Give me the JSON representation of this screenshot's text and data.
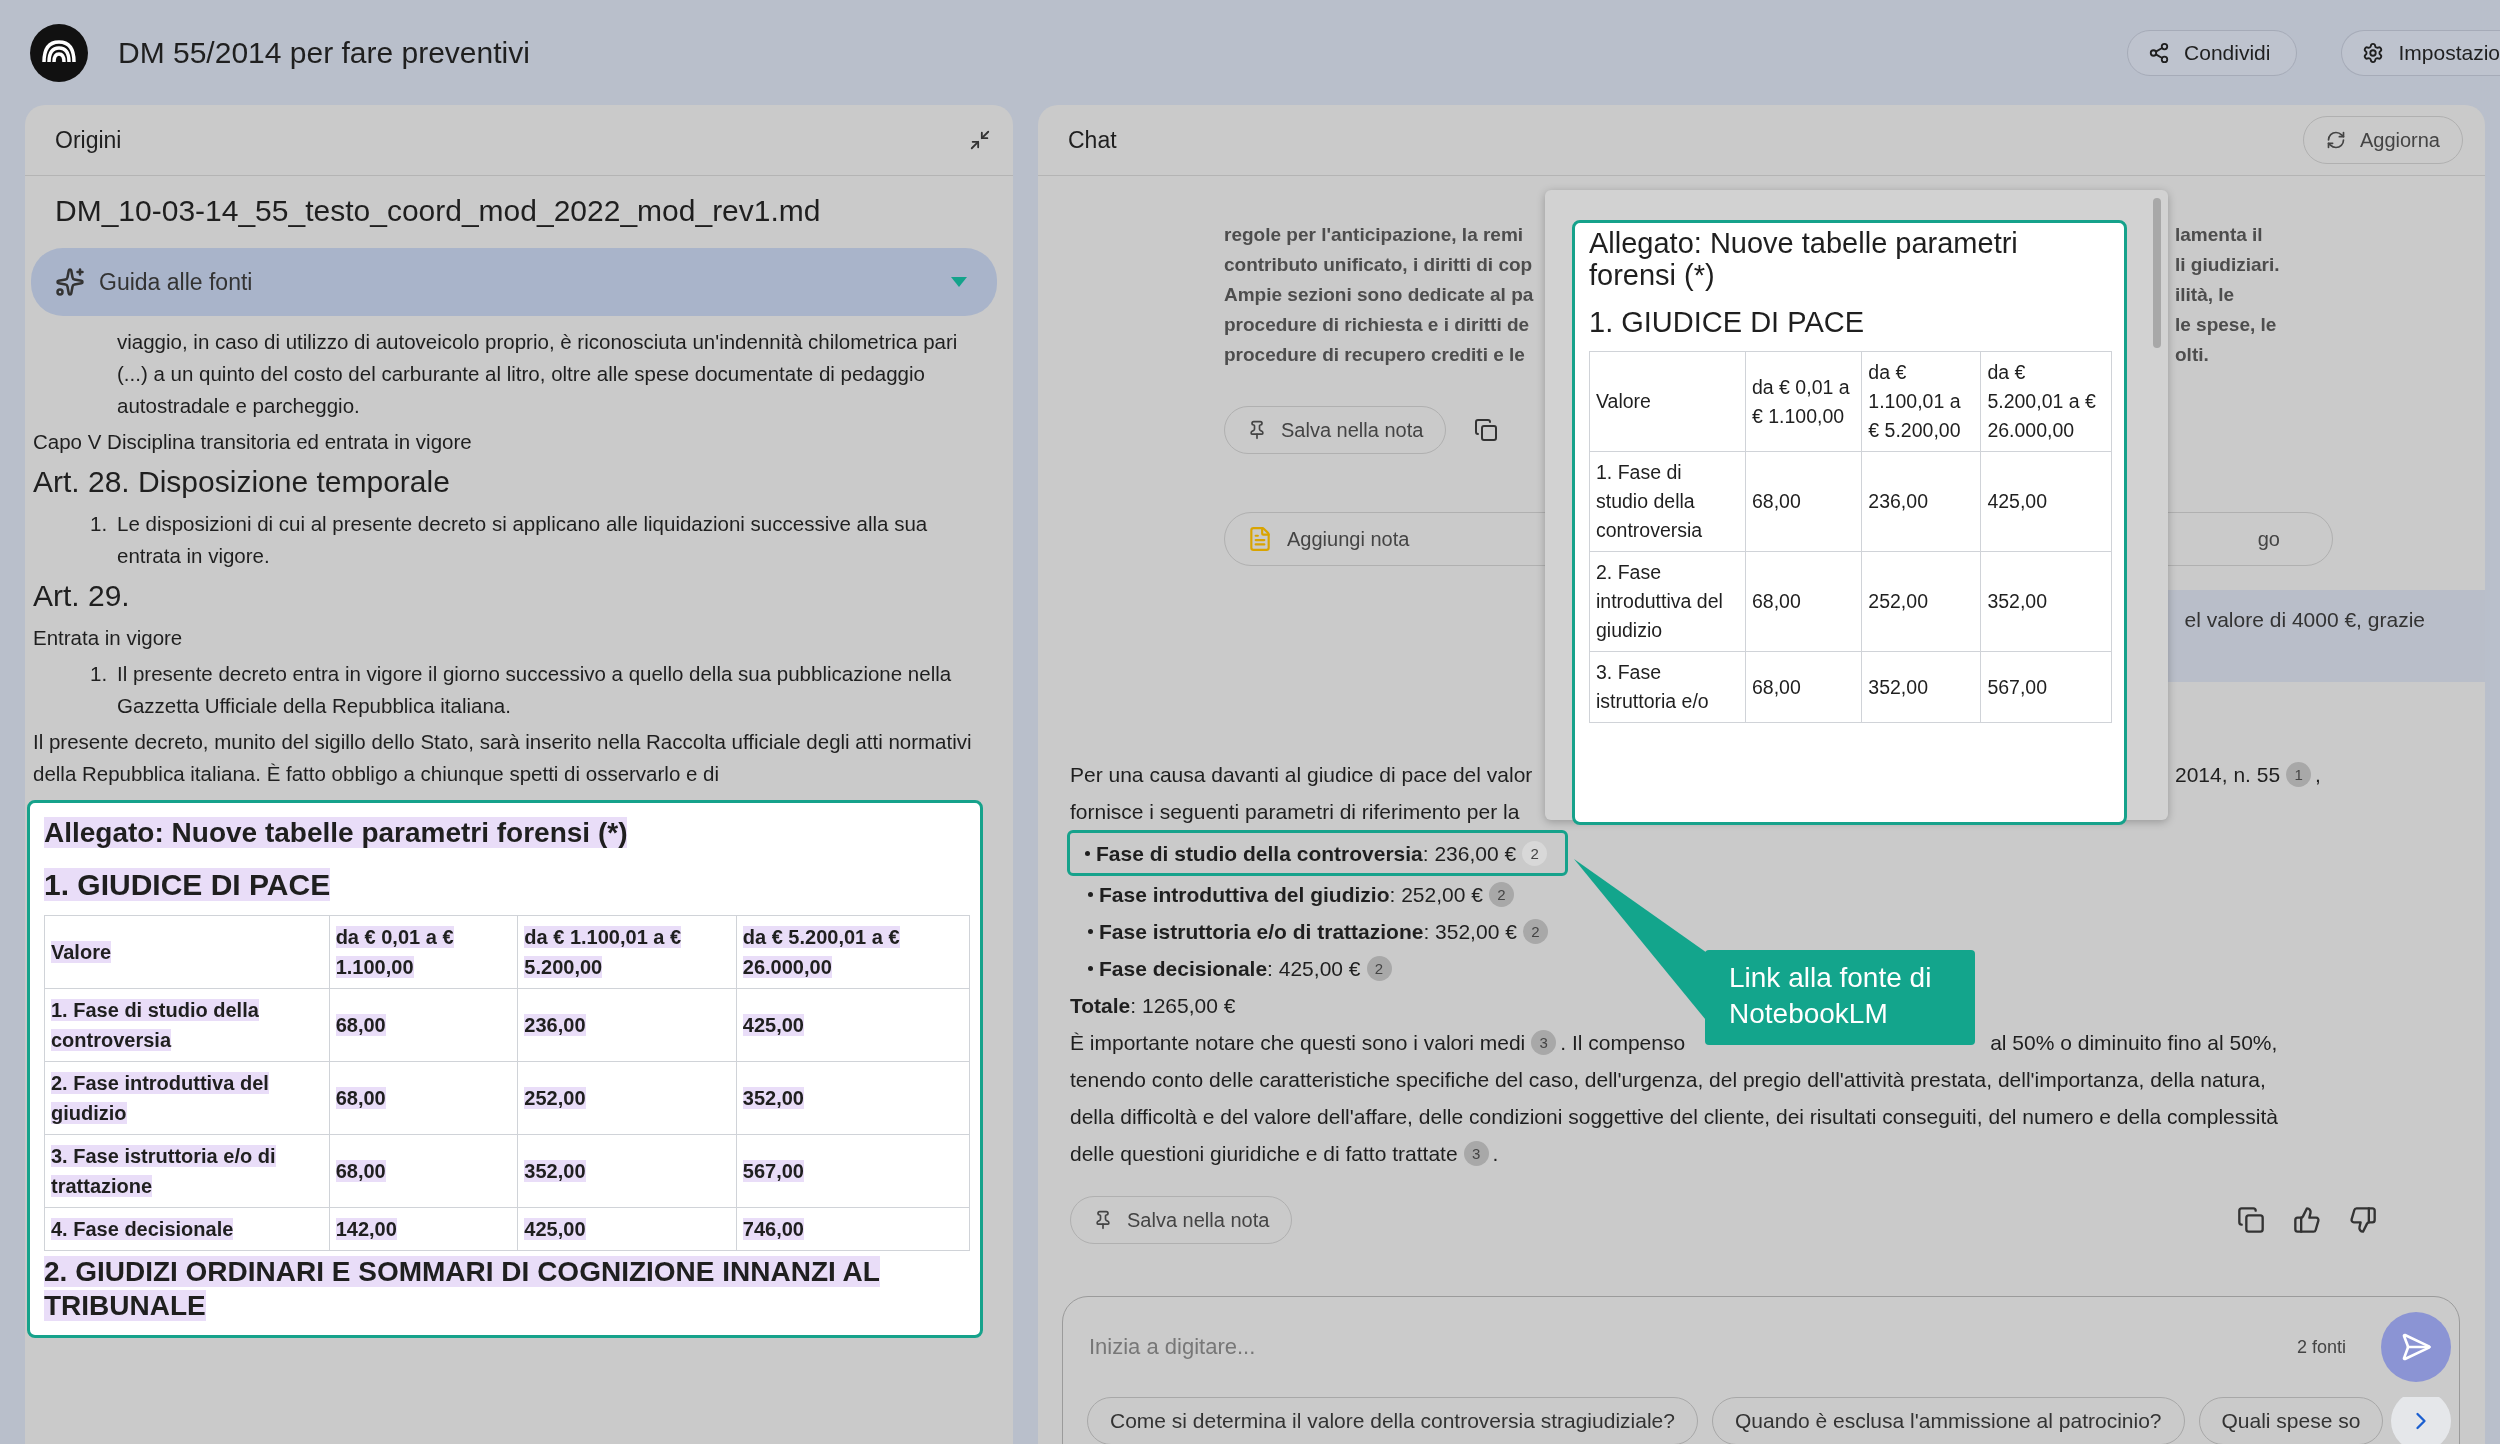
{
  "header": {
    "title": "DM 55/2014 per fare preventivi",
    "buttons": [
      {
        "label": "Condividi"
      },
      {
        "label": "Impostazio"
      }
    ]
  },
  "sources": {
    "title": "Origini",
    "file_name": "DM_10-03-14_55_testo_coord_mod_2022_mod_rev1.md",
    "guide": {
      "label": "Guida alle fonti"
    },
    "blocks": [
      {
        "kind": "indent",
        "text": "viaggio, in caso di utilizzo di autoveicolo proprio, è riconosciuta un'indennità chilometrica pari (...) a un quinto del costo del carburante al litro, oltre alle spese documentate di pedaggio autostradale e parcheggio."
      },
      {
        "kind": "para",
        "text": "Capo V Disciplina transitoria ed entrata in vigore"
      },
      {
        "kind": "heading",
        "text": "Art. 28. Disposizione temporale"
      },
      {
        "kind": "item",
        "number": "1.",
        "text": "Le disposizioni di cui al presente decreto si applicano alle liquidazioni successive alla sua entrata in vigore."
      },
      {
        "kind": "heading",
        "text": "Art. 29."
      },
      {
        "kind": "para",
        "text": "Entrata in vigore"
      },
      {
        "kind": "item",
        "number": "1.",
        "text": "Il presente decreto entra in vigore il giorno successivo a quello della sua pubblicazione nella Gazzetta Ufficiale della Repubblica italiana."
      },
      {
        "kind": "para",
        "text": "Il presente decreto, munito del sigillo dello Stato, sarà inserito nella Raccolta ufficiale degli atti normativi della Repubblica italiana. È fatto obbligo a chiunque spetti di osservarlo e di"
      }
    ],
    "excerpt": {
      "title": "Allegato: Nuove tabelle parametri forensi (*)",
      "section": "1. GIUDICE DI PACE",
      "table": {
        "columns": [
          "Valore",
          "da € 0,01 a € 1.100,00",
          "da € 1.100,01 a € 5.200,00",
          "da € 5.200,01 a € 26.000,00"
        ],
        "rows": [
          [
            "1. Fase di studio della controversia",
            "68,00",
            "236,00",
            "425,00"
          ],
          [
            "2. Fase introduttiva del giudizio",
            "68,00",
            "252,00",
            "352,00"
          ],
          [
            "3. Fase istruttoria e/o di trattazione",
            "68,00",
            "352,00",
            "567,00"
          ],
          [
            "4. Fase decisionale",
            "142,00",
            "425,00",
            "746,00"
          ]
        ]
      },
      "next_section": "2. GIUDIZI ORDINARI E SOMMARI DI COGNIZIONE INNANZI AL TRIBUNALE"
    }
  },
  "chat": {
    "title": "Chat",
    "refresh": "Aggiorna",
    "summary_lines": [
      {
        "left": "regole per l'anticipazione, la remi",
        "right": "lamenta il"
      },
      {
        "left": "contributo unificato, i diritti di cop",
        "right": "li giudiziari."
      },
      {
        "left": "Ampie sezioni sono dedicate al pa",
        "right": "ilità, le"
      },
      {
        "left": "procedure di richiesta e i diritti de",
        "right": "le spese, le"
      },
      {
        "left": "procedure di recupero crediti e le",
        "right": "olti."
      }
    ],
    "save_note": "Salva nella nota",
    "add_note": "Aggiungi nota",
    "other_action": "go",
    "user_message": "el valore di 4000 €, grazie",
    "intro": [
      {
        "left": "Per una causa davanti al giudice di pace del valor",
        "right": "2014, n. 55",
        "cite": "1",
        "tail": ","
      },
      {
        "left": "fornisce i seguenti parametri di riferimento per la"
      }
    ],
    "bullets": [
      {
        "label": "Fase di studio della controversia",
        "value": ": 236,00 €",
        "cite": "2",
        "highlighted": true
      },
      {
        "label": "Fase introduttiva del giudizio",
        "value": ": 252,00 €",
        "cite": "2",
        "highlighted": false
      },
      {
        "label": "Fase istruttoria e/o di trattazione",
        "value": ": 352,00 €",
        "cite": "2",
        "highlighted": false
      },
      {
        "label": "Fase decisionale",
        "value": ": 425,00 €",
        "cite": "2",
        "highlighted": false
      }
    ],
    "total": {
      "label": "Totale",
      "value": ": 1265,00 €"
    },
    "note_lines": [
      {
        "left": "È importante notare che questi sono i valori medi",
        "cite": "3",
        "tail": ". Il compenso",
        "right": "al 50% o diminuito fino al 50%,"
      },
      {
        "left": "tenendo conto delle caratteristiche specifiche del caso, dell'urgenza, del pregio dell'attività prestata, dell'importanza, della natura,"
      },
      {
        "left": "della difficoltà e del valore dell'affare, delle condizioni soggettive del cliente, dei risultati conseguiti, del numero e della complessità"
      },
      {
        "left": "delle questioni giuridiche e di fatto trattate",
        "cite": "3",
        "tail": "."
      }
    ],
    "answer_save": "Salva nella nota",
    "input": {
      "placeholder": "Inizia a digitare...",
      "sources": "2 fonti"
    },
    "suggestions": [
      "Come si determina il valore della controversia stragiudiziale?",
      "Quando è esclusa l'ammissione al patrocinio?",
      "Quali spese so"
    ],
    "popup": {
      "title": "Allegato: Nuove tabelle parametri forensi (*)",
      "section": "1. GIUDICE DI PACE",
      "table": {
        "columns": [
          "Valore",
          "da € 0,01 a € 1.100,00",
          "da € 1.100,01 a € 5.200,00",
          "da € 5.200,01 a € 26.000,00"
        ],
        "rows": [
          [
            "1. Fase di studio della controversia",
            "68,00",
            "236,00",
            "425,00"
          ],
          [
            "2. Fase introduttiva del giudizio",
            "68,00",
            "252,00",
            "352,00"
          ],
          [
            "3. Fase istruttoria e/o",
            "68,00",
            "352,00",
            "567,00"
          ]
        ]
      }
    },
    "callout": "Link alla fonte di NotebookLM"
  }
}
